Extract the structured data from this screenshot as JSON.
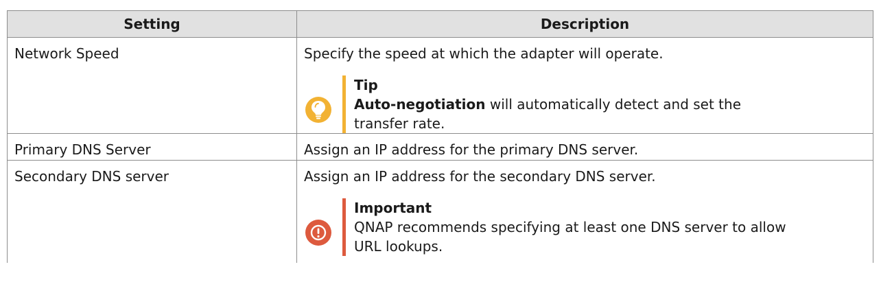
{
  "table": {
    "headers": {
      "setting": "Setting",
      "description": "Description"
    },
    "rows": [
      {
        "setting": "Network Speed",
        "description": "Specify the speed at which the adapter will operate.",
        "callout": {
          "kind": "tip",
          "icon": "lightbulb-icon",
          "color": "#f2b233",
          "title": "Tip",
          "bold_lead": "Auto-negotiation",
          "text": " will automatically detect and set the transfer rate."
        }
      },
      {
        "setting": "Primary DNS Server",
        "description": "Assign an IP address for the primary DNS server."
      },
      {
        "setting": "Secondary DNS server",
        "description": "Assign an IP address for the secondary DNS server.",
        "callout": {
          "kind": "important",
          "icon": "exclamation-icon",
          "color": "#dd5a3e",
          "title": "Important",
          "text": "QNAP recommends specifying at least one DNS server to allow URL lookups."
        }
      }
    ]
  }
}
